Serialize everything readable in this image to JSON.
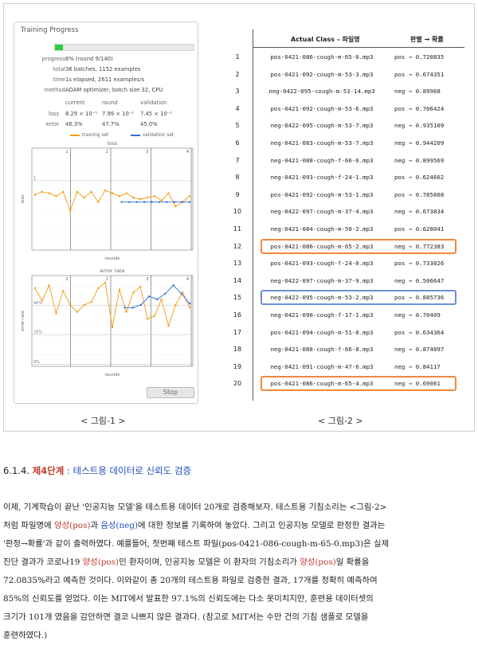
{
  "figure1": {
    "panel_title": "Training Progress",
    "progress_fraction": 0.06,
    "rows": [
      {
        "key": "progress",
        "value": "6% (round 9/140)"
      },
      {
        "key": "total",
        "value": "36 batches, 1152 examples"
      },
      {
        "key": "time",
        "value": "1s elapsed, 2611 examples/s"
      },
      {
        "key": "method",
        "value": "ADAM optimizer, batch size 32, CPU"
      }
    ],
    "metric_headers": [
      "current",
      "round",
      "validation"
    ],
    "metrics": [
      {
        "key": "loss",
        "values": [
          "8.29 × 10⁻¹",
          "7.99 × 10⁻¹",
          "7.45 × 10⁻¹"
        ]
      },
      {
        "key": "error",
        "values": [
          "46.3%",
          "47.7%",
          "45.0%"
        ]
      }
    ],
    "legend": {
      "training": "training set",
      "validation": "validation set"
    },
    "colors": {
      "training": "#f39c12",
      "validation": "#2e6fd1",
      "progress": "#2ecc40"
    },
    "stop_label": "Stop",
    "caption": "< 그림-1 >"
  },
  "chart_data": [
    {
      "type": "line",
      "title": "loss",
      "xlabel": "rounds",
      "ylabel": "loss",
      "x_ticks": [
        "1",
        "2",
        "3",
        "4"
      ],
      "y_ticks": [
        "1"
      ],
      "series": [
        {
          "name": "training set",
          "values": [
            0.98,
            1.0,
            0.99,
            0.97,
            1.0,
            0.87,
            1.0,
            0.96,
            1.0,
            0.93,
            1.01,
            0.99,
            0.97,
            0.99,
            0.96,
            0.95,
            0.96,
            0.97,
            0.94,
            0.99,
            0.9,
            0.93,
            0.97
          ]
        },
        {
          "name": "validation set",
          "values": [
            0.93,
            0.93,
            0.93,
            0.93,
            0.93,
            0.93,
            0.93,
            0.93,
            0.93,
            0.93
          ]
        }
      ],
      "grid": true
    },
    {
      "type": "line",
      "title": "error rate",
      "xlabel": "rounds",
      "ylabel": "error rate",
      "x_ticks": [
        "1",
        "2",
        "3",
        "4"
      ],
      "y_ticks": [
        "40%",
        "20%",
        "0%"
      ],
      "series": [
        {
          "name": "training set",
          "values": [
            56,
            47,
            58,
            38,
            54,
            44,
            39,
            44,
            46,
            56,
            60,
            28,
            55,
            39,
            53,
            57,
            34,
            36,
            48,
            29,
            44,
            53,
            42
          ]
        },
        {
          "name": "validation set",
          "values": [
            42,
            42,
            44,
            50,
            48,
            52,
            58,
            52,
            45
          ]
        }
      ],
      "grid": true
    }
  ],
  "figure2": {
    "header_class": "Actual Class – 파일명",
    "header_pred": "판별 → 확률",
    "rows": [
      {
        "n": "1",
        "file": "pos-0421-086-cough-m-65-0.mp3",
        "pred": "pos → 0.720835"
      },
      {
        "n": "2",
        "file": "pos-0421-092-cough-m-53-3.mp3",
        "pred": "pos → 0.674351"
      },
      {
        "n": "3",
        "file": "neg-0422-095-cough-m-53-14.mp3",
        "pred": "neg → 0.89968"
      },
      {
        "n": "4",
        "file": "pos-0421-092-cough-m-53-6.mp3",
        "pred": "pos → 0.706424"
      },
      {
        "n": "5",
        "file": "neg-0422-095-cough-m-53-7.mp3",
        "pred": "neg → 0.935109"
      },
      {
        "n": "6",
        "file": "neg-0421-083-cough-m-53-7.mp3",
        "pred": "neg → 0.944209"
      },
      {
        "n": "7",
        "file": "neg-0421-088-cough-f-66-0.mp3",
        "pred": "neg → 0.899569"
      },
      {
        "n": "8",
        "file": "neg-0421-093-cough-f-24-1.mp3",
        "pred": "pos → 0.624602"
      },
      {
        "n": "9",
        "file": "pos-0421-092-cough-m-53-1.mp3",
        "pred": "pos → 0.785808"
      },
      {
        "n": "10",
        "file": "neg-0422-097-cough-m-37-4.mp3",
        "pred": "neg → 0.673834"
      },
      {
        "n": "11",
        "file": "neg-0421-084-cough-m-50-2.mp3",
        "pred": "pos → 0.628041"
      },
      {
        "n": "12",
        "file": "pos-0421-086-cough-m-65-2.mp3",
        "pred": "neg → 0.772383"
      },
      {
        "n": "13",
        "file": "pos-0421-093-cough-f-24-0.mp3",
        "pred": "pos → 0.733026"
      },
      {
        "n": "14",
        "file": "neg-0422-097-cough-m-37-9.mp3",
        "pred": "neg → 0.506647"
      },
      {
        "n": "15",
        "file": "neg-0422-095-cough-m-53-2.mp3",
        "pred": "pos → 0.885736"
      },
      {
        "n": "16",
        "file": "neg-0421-090-cough-f-17-1.mp3",
        "pred": "neg → 0.70409"
      },
      {
        "n": "17",
        "file": "pos-0421-094-cough-m-51-0.mp3",
        "pred": "pos → 0.634364"
      },
      {
        "n": "18",
        "file": "neg-0421-088-cough-f-66-8.mp3",
        "pred": "neg → 0.874897"
      },
      {
        "n": "19",
        "file": "neg-0421-091-cough-m-47-6.mp3",
        "pred": "neg → 0.84117"
      },
      {
        "n": "20",
        "file": "pos-0421-086-cough-m-65-4.mp3",
        "pred": "neg → 0.69061"
      }
    ],
    "highlights": [
      {
        "row": 12,
        "color": "#f0883e"
      },
      {
        "row": 15,
        "color": "#6c8fd6"
      },
      {
        "row": 20,
        "color": "#f0883e"
      }
    ],
    "caption": "< 그림-2 >"
  },
  "section": {
    "number": "6.1.4.",
    "step": "제4단계",
    "title": " : 테스트용 데이터로 신뢰도 검증"
  },
  "body": {
    "l1": "이제, 기계학습이 끝난 '인공지능 모델'을 테스트용 데이터 20개로 검증해보자. 테스트용 기침소리는 <그림-2>",
    "l2a": "처럼 파일명에 ",
    "l2b": "양성(pos)",
    "l2c": "과 ",
    "l2d": "음성(neg)",
    "l2e": "에 대한 정보를 기록하여 놓았다. 그리고 인공지능 모델로 판정한 결과는",
    "l3": "'판정→확률'과 같이 출력하였다. 예를들어, 첫번째 테스트 파일(pos-0421-086-cough-m-65-0.mp3)은 실제",
    "l4a": "진단 결과가 코로나19 ",
    "l4b": "양성(pos)",
    "l4c": "인 환자이며, 인공지능 모델은 이 환자의 기침소리가 ",
    "l4d": "양성(pos)",
    "l4e": "일 확률을",
    "l5": "72.0835%라고 예측한 것이다. 이와같이 총 20개의 테스트용 파일로 검증한 결과, 17개를 정확히 예측하여",
    "l6": "85%의 신뢰도를 얻었다. 이는 MIT에서 발표한 97.1%의 신뢰도에는 다소 못미치지만, 훈련용 데이터셋의",
    "l7": "크기가 101개 였음을 감안하면 결코 나쁘지 않은 결과다. (참고로 MIT서는 수만 건의 기침 샘플로 모델을",
    "l8": "훈련하였다.)"
  }
}
